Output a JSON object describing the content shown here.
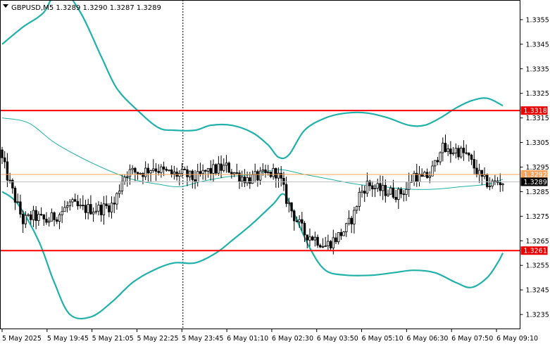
{
  "symbol_header": {
    "text": "GBPUSD,M5  1.3289 1.3290 1.3287 1.3289",
    "dropdown_icon": "triangle-down-icon"
  },
  "colors": {
    "background": "#ffffff",
    "frame": "#000000",
    "grid": "#d3d3d3",
    "bollinger": "#20b2aa",
    "candles": "#000000",
    "support_resistance": "#ff0000",
    "bid_line": "#f4a460",
    "ask_line": "#c0c0c0",
    "price_tag_red": "#e60000",
    "price_tag_current": "#000000"
  },
  "chart_data": {
    "type": "candlestick",
    "instrument": "GBPUSD",
    "timeframe": "M5",
    "ohlc_header": {
      "open": 1.3289,
      "high": 1.329,
      "low": 1.3287,
      "close": 1.3289
    },
    "ylim": [
      1.3229,
      1.3363
    ],
    "y_ticks": [
      "1.3235",
      "1.3245",
      "1.3255",
      "1.3265",
      "1.3275",
      "1.3285",
      "1.3295",
      "1.3305",
      "1.3315",
      "1.3325",
      "1.3335",
      "1.3345",
      "1.3355"
    ],
    "x_ticks": [
      "5 May 2025",
      "5 May 19:45",
      "5 May 21:05",
      "5 May 22:25",
      "5 May 23:45",
      "6 May 01:10",
      "6 May 02:30",
      "6 May 03:50",
      "6 May 05:10",
      "6 May 06:30",
      "6 May 07:50",
      "6 May 09:10"
    ],
    "vertical_marker": "5 May 23:45",
    "close_anchors": [
      [
        0,
        1.3298
      ],
      [
        3,
        1.3288
      ],
      [
        5,
        1.3282
      ],
      [
        8,
        1.3273
      ],
      [
        12,
        1.3275
      ],
      [
        17,
        1.3273
      ],
      [
        22,
        1.3276
      ],
      [
        26,
        1.328
      ],
      [
        30,
        1.3278
      ],
      [
        38,
        1.3278
      ],
      [
        43,
        1.328
      ],
      [
        46,
        1.329
      ],
      [
        48,
        1.3293
      ],
      [
        54,
        1.3293
      ],
      [
        58,
        1.3295
      ],
      [
        62,
        1.3293
      ],
      [
        66,
        1.3292
      ],
      [
        70,
        1.3292
      ],
      [
        74,
        1.329
      ],
      [
        78,
        1.3293
      ],
      [
        82,
        1.3294
      ],
      [
        86,
        1.3295
      ],
      [
        90,
        1.3292
      ],
      [
        94,
        1.329
      ],
      [
        98,
        1.3291
      ],
      [
        102,
        1.3292
      ],
      [
        105,
        1.3293
      ],
      [
        107,
        1.3289
      ],
      [
        109,
        1.3282
      ],
      [
        112,
        1.3275
      ],
      [
        116,
        1.3268
      ],
      [
        120,
        1.3266
      ],
      [
        124,
        1.3263
      ],
      [
        128,
        1.3266
      ],
      [
        132,
        1.327
      ],
      [
        135,
        1.3276
      ],
      [
        137,
        1.3284
      ],
      [
        140,
        1.3288
      ],
      [
        144,
        1.3286
      ],
      [
        148,
        1.3285
      ],
      [
        152,
        1.3284
      ],
      [
        155,
        1.3286
      ],
      [
        158,
        1.3292
      ],
      [
        161,
        1.329
      ],
      [
        164,
        1.3292
      ],
      [
        166,
        1.3296
      ],
      [
        168,
        1.3303
      ],
      [
        171,
        1.3301
      ],
      [
        174,
        1.3302
      ],
      [
        178,
        1.33
      ],
      [
        181,
        1.3295
      ],
      [
        184,
        1.329
      ],
      [
        187,
        1.3288
      ],
      [
        190,
        1.3289
      ],
      [
        192,
        1.3289
      ]
    ],
    "bollinger_upper": [
      [
        0,
        1.3345
      ],
      [
        8,
        1.3352
      ],
      [
        16,
        1.3358
      ],
      [
        22,
        1.3368
      ],
      [
        30,
        1.3358
      ],
      [
        38,
        1.334
      ],
      [
        44,
        1.3327
      ],
      [
        52,
        1.3318
      ],
      [
        60,
        1.3311
      ],
      [
        66,
        1.331
      ],
      [
        74,
        1.331
      ],
      [
        80,
        1.3312
      ],
      [
        88,
        1.3312
      ],
      [
        96,
        1.3309
      ],
      [
        102,
        1.3304
      ],
      [
        106,
        1.3299
      ],
      [
        110,
        1.33
      ],
      [
        116,
        1.331
      ],
      [
        124,
        1.3315
      ],
      [
        132,
        1.3317
      ],
      [
        140,
        1.3317
      ],
      [
        148,
        1.3315
      ],
      [
        156,
        1.3312
      ],
      [
        162,
        1.3312
      ],
      [
        168,
        1.3315
      ],
      [
        174,
        1.3319
      ],
      [
        180,
        1.3322
      ],
      [
        186,
        1.3323
      ],
      [
        192,
        1.332
      ]
    ],
    "bollinger_middle": [
      [
        0,
        1.3315
      ],
      [
        10,
        1.3313
      ],
      [
        20,
        1.3305
      ],
      [
        30,
        1.3299
      ],
      [
        40,
        1.3294
      ],
      [
        50,
        1.329
      ],
      [
        60,
        1.3288
      ],
      [
        68,
        1.3287
      ],
      [
        76,
        1.3289
      ],
      [
        86,
        1.3291
      ],
      [
        96,
        1.3292
      ],
      [
        106,
        1.3294
      ],
      [
        116,
        1.3292
      ],
      [
        126,
        1.329
      ],
      [
        136,
        1.3288
      ],
      [
        146,
        1.3287
      ],
      [
        156,
        1.3286
      ],
      [
        166,
        1.3286
      ],
      [
        176,
        1.3287
      ],
      [
        186,
        1.3288
      ],
      [
        192,
        1.329
      ]
    ],
    "bollinger_lower": [
      [
        0,
        1.3285
      ],
      [
        6,
        1.328
      ],
      [
        14,
        1.3265
      ],
      [
        20,
        1.3248
      ],
      [
        26,
        1.3235
      ],
      [
        34,
        1.3234
      ],
      [
        42,
        1.324
      ],
      [
        50,
        1.3248
      ],
      [
        58,
        1.3253
      ],
      [
        66,
        1.3256
      ],
      [
        74,
        1.3256
      ],
      [
        82,
        1.326
      ],
      [
        88,
        1.3265
      ],
      [
        96,
        1.3272
      ],
      [
        104,
        1.328
      ],
      [
        108,
        1.3284
      ],
      [
        112,
        1.3276
      ],
      [
        118,
        1.3262
      ],
      [
        124,
        1.3253
      ],
      [
        132,
        1.3251
      ],
      [
        142,
        1.3251
      ],
      [
        150,
        1.3252
      ],
      [
        158,
        1.3253
      ],
      [
        166,
        1.3252
      ],
      [
        174,
        1.3248
      ],
      [
        180,
        1.3246
      ],
      [
        186,
        1.325
      ],
      [
        190,
        1.3256
      ],
      [
        192,
        1.326
      ]
    ],
    "horizontal_levels": [
      {
        "price": 1.3318,
        "label": "1.3318",
        "kind": "resistance"
      },
      {
        "price": 1.3261,
        "label": "1.3261",
        "kind": "support"
      }
    ],
    "price_lines": [
      {
        "price": 1.3292,
        "label": "1.3292",
        "kind": "bid"
      },
      {
        "price": 1.3289,
        "label": "1.3289",
        "kind": "current"
      }
    ]
  }
}
